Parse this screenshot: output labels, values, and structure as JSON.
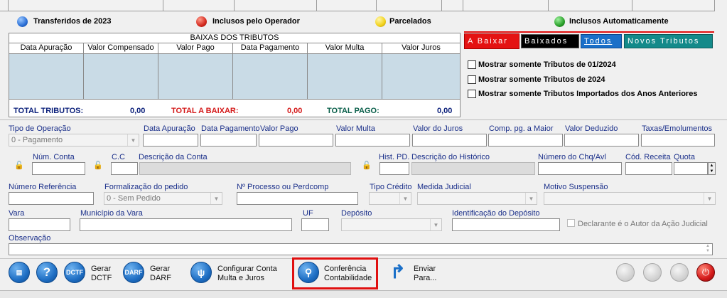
{
  "legend": {
    "transferidos": "Transferidos de 2023",
    "inclusos_operador": "Inclusos pelo Operador",
    "parcelados": "Parcelados",
    "inclusos_auto": "Inclusos Automaticamente",
    "colors": {
      "blue": "#2a6fd6",
      "red": "#d42a1f",
      "yellow": "#f2d21a",
      "green": "#2aa02a"
    }
  },
  "baixas": {
    "title": "BAIXAS DOS TRIBUTOS",
    "columns": [
      "Data Apuração",
      "Valor Compensado",
      "Valor Pago",
      "Data Pagamento",
      "Valor Multa",
      "Valor Juros"
    ],
    "totals": {
      "tributos_label": "TOTAL TRIBUTOS:",
      "tributos_value": "0,00",
      "a_baixar_label": "TOTAL A BAIXAR:",
      "a_baixar_value": "0,00",
      "pago_label": "TOTAL PAGO:",
      "pago_value": "0,00"
    }
  },
  "tabs": {
    "a_baixar": "A Baixar",
    "baixados": "Baixados",
    "todos": "Todos",
    "novos": "Novos Tributos"
  },
  "options": {
    "opt1": "Mostrar somente Tributos de 01/2024",
    "opt2": "Mostrar somente Tributos de 2024",
    "opt3": "Mostrar somente Tributos Importados dos Anos Anteriores"
  },
  "form": {
    "tipo_operacao_label": "Tipo de Operação",
    "tipo_operacao_value": "0 - Pagamento",
    "data_apuracao": "Data Apuração",
    "data_pagamento": "Data Pagamento",
    "valor_pago": "Valor Pago",
    "valor_multa": "Valor Multa",
    "valor_juros": "Valor do Juros",
    "comp_pg": "Comp. pg. a Maior",
    "valor_deduzido": "Valor Deduzido",
    "taxas": "Taxas/Emolumentos",
    "num_conta": "Núm. Conta",
    "cc": "C.C",
    "descricao_conta": "Descrição da Conta",
    "hist_pd": "Hist. PD.",
    "descricao_historico": "Descrição do Histórico",
    "numero_chq": "Número do Chq/Avl",
    "cod_receita": "Cód. Receita",
    "quota": "Quota",
    "numero_referencia": "Número Referência",
    "formalizacao_label": "Formalização do pedido",
    "formalizacao_value": "0 - Sem Pedido",
    "processo": "Nº Processo ou Perdcomp",
    "tipo_credito": "Tipo Crédito",
    "medida_judicial": "Medida Judicial",
    "motivo_suspensao": "Motivo Suspensão",
    "vara": "Vara",
    "municipio_vara": "Município da Vara",
    "uf": "UF",
    "deposito": "Depósito",
    "identificacao_deposito": "Identificação do Depósito",
    "declarante": "Declarante é o Autor da Ação Judicial",
    "observacao": "Observação"
  },
  "toolbar": {
    "gerar_dctf": "Gerar\nDCTF",
    "gerar_darf": "Gerar\nDARF",
    "configurar": "Configurar Conta\nMulta e Juros",
    "conferencia": "Conferência\nContabilidade",
    "enviar": "Enviar\nPara...",
    "dctf_icon_text": "DCTF",
    "darf_icon_text": "DARF"
  }
}
